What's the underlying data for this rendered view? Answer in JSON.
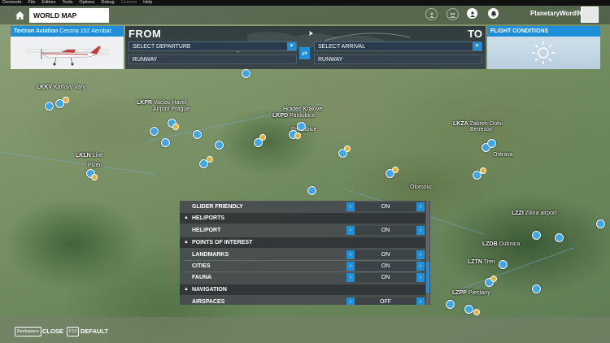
{
  "devbar": {
    "items": [
      "Devmode",
      "File",
      "Editors",
      "Tools",
      "Options",
      "Debug",
      "Camera",
      "Help"
    ]
  },
  "nav": {
    "tab_label": "WORLD MAP",
    "username": "PlanetaryWord90"
  },
  "aircraft": {
    "maker": "Textron Aviation",
    "model": "Cessna 152 Aerobat"
  },
  "route": {
    "from_label": "FROM",
    "to_label": "TO",
    "departure_placeholder": "SELECT DEPARTURE",
    "arrival_placeholder": "SELECT ARRIVAL",
    "departure_runway": "RUNWAY",
    "arrival_runway": "RUNWAY"
  },
  "conditions": {
    "title": "FLIGHT CONDITIONS"
  },
  "map": {
    "labels": {
      "lkkv": "LKKV",
      "karlovy_vary": "Karlovy Vary",
      "lkpr": "LKPR",
      "vaclav_havel": "Vaclav Havel",
      "airport_prague": "Airport Prague",
      "hradec_kralove": "Hradec Kralove",
      "lkpd": "LKPD",
      "pardubice": "Pardubice",
      "pardubice2": "Pardubice",
      "lkza": "LKZA",
      "zabreh_dolni": "Zabreh-Dolni",
      "benesov": "Benesov",
      "ostrava": "Ostrava",
      "lkln": "LKLN",
      "line": "Line",
      "plzen": "Plzen",
      "olomouc": "Olomouc",
      "lzzi": "LZZI",
      "zilina": "Zilina airport",
      "lzdb": "LZDB",
      "dubnica": "Dubnica",
      "lztn": "LZTN",
      "trencin": "Tren",
      "lzpp": "LZPP",
      "piestany": "Piestany"
    }
  },
  "filters": {
    "rows": [
      {
        "type": "row",
        "label": "GLIDER FRIENDLY",
        "value": "ON"
      },
      {
        "type": "section",
        "label": "HELIPORTS"
      },
      {
        "type": "row",
        "label": "HELIPORT",
        "value": "ON"
      },
      {
        "type": "section",
        "label": "POINTS OF INTEREST"
      },
      {
        "type": "row",
        "label": "LANDMARKS",
        "value": "ON"
      },
      {
        "type": "row",
        "label": "CITIES",
        "value": "ON"
      },
      {
        "type": "row",
        "label": "FAUNA",
        "value": "ON"
      },
      {
        "type": "section",
        "label": "NAVIGATION"
      },
      {
        "type": "row",
        "label": "AIRSPACES",
        "value": "OFF"
      }
    ]
  },
  "bottom": {
    "close_key": "Backspace",
    "close_label": "CLOSE",
    "default_key": "F12",
    "default_label": "DEFAULT"
  },
  "colors": {
    "accent": "#1e8fd8",
    "pin": "#3fa7e6",
    "pin_poi": "#e0b23a"
  }
}
